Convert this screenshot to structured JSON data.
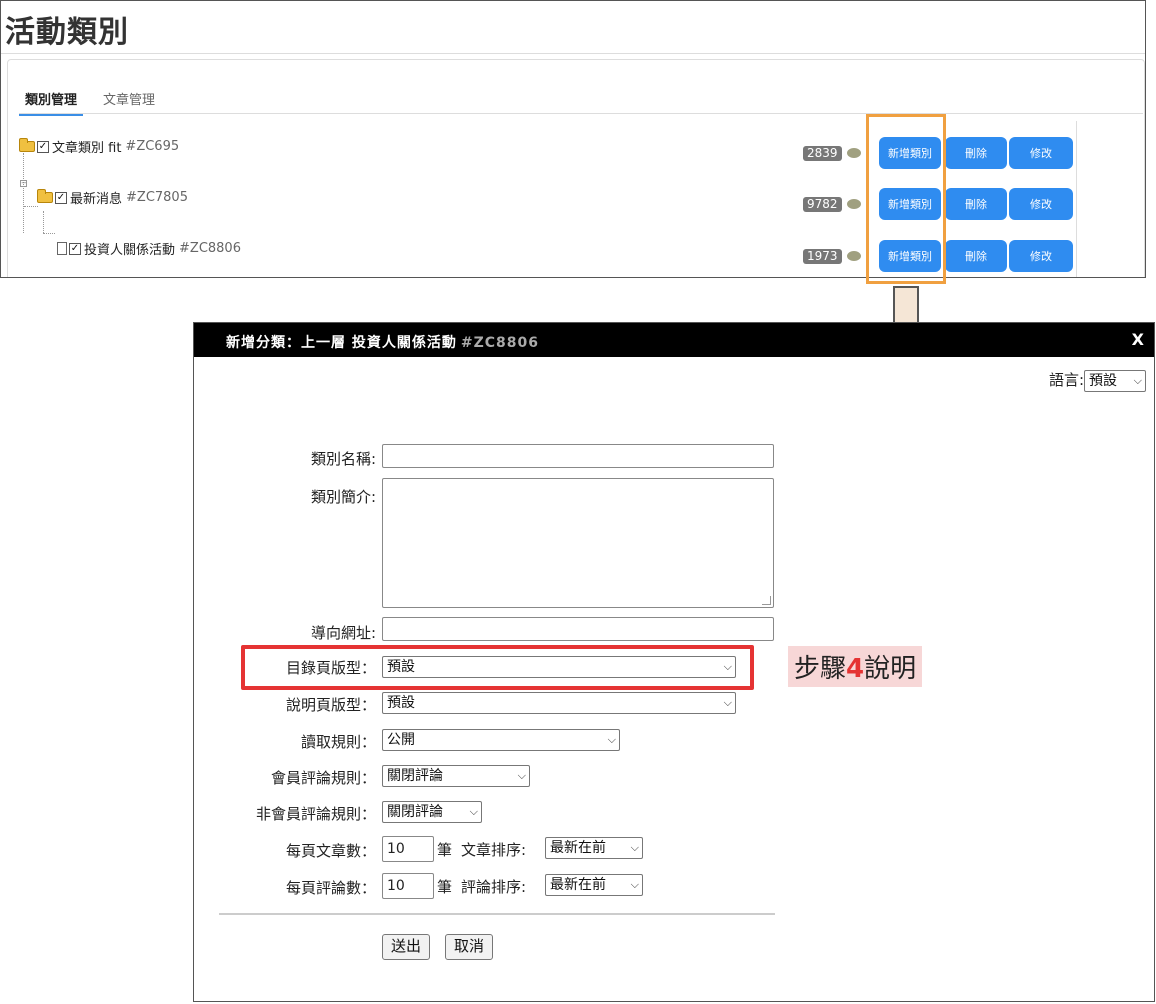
{
  "page": {
    "title": "活動類別",
    "tabs": [
      {
        "label": "類別管理"
      },
      {
        "label": "文章管理"
      }
    ]
  },
  "tree": {
    "rows": [
      {
        "name": "文章類別 fit",
        "code": "#ZC695",
        "count": "2839"
      },
      {
        "name": "最新消息",
        "code": "#ZC7805",
        "count": "9782"
      },
      {
        "name": "投資人關係活動",
        "code": "#ZC8806",
        "count": "1973"
      }
    ],
    "buttons": {
      "new": "新增類別",
      "delete": "刪除",
      "edit": "修改"
    }
  },
  "dialog": {
    "title": "新增分類：上一層 投資人關係活動",
    "title_code": "#ZC8806",
    "close": "X",
    "language_label": "語言:",
    "language_value": "預設",
    "fields": {
      "category_name": "類別名稱:",
      "category_intro": "類別簡介:",
      "redirect_url": "導向網址:",
      "list_layout": "目錄頁版型：",
      "list_layout_value": "預設",
      "detail_layout": "說明頁版型：",
      "detail_layout_value": "預設",
      "read_rule": "讀取規則：",
      "read_rule_value": "公開",
      "member_comment_rule": "會員評論規則：",
      "member_comment_value": "關閉評論",
      "guest_comment_rule": "非會員評論規則：",
      "guest_comment_value": "關閉評論",
      "articles_per_page": "每頁文章數：",
      "articles_per_page_value": "10",
      "unit": "筆",
      "article_sort_label": "文章排序:",
      "article_sort_value": "最新在前",
      "comments_per_page": "每頁評論數：",
      "comments_per_page_value": "10",
      "comment_sort_label": "評論排序:",
      "comment_sort_value": "最新在前"
    },
    "submit": "送出",
    "cancel": "取消"
  },
  "annotation": {
    "step_prefix": "步驟",
    "step_number": "4",
    "step_suffix": "說明"
  },
  "colors": {
    "blue_button": "#2f8cf0",
    "orange_highlight": "#f0a040",
    "red_highlight": "#e53333",
    "note_background": "#f7d7d7"
  }
}
